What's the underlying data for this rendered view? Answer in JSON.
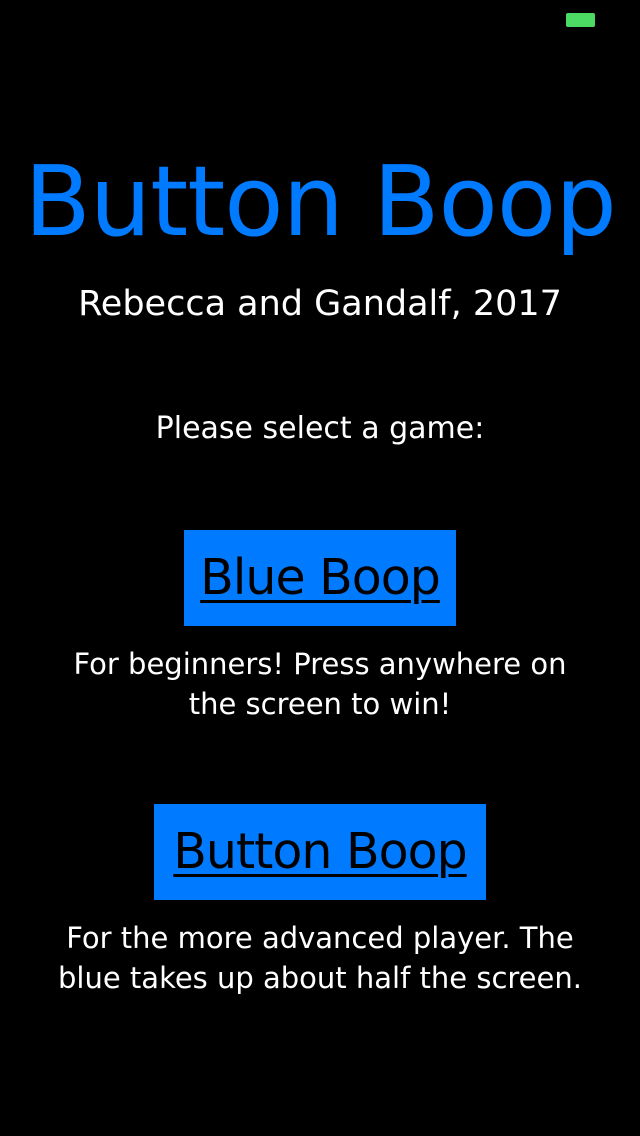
{
  "colors": {
    "background": "#000000",
    "accent": "#007AFF",
    "text": "#FFFFFF",
    "battery": "#4CD964"
  },
  "status_bar": {
    "battery_icon": "battery-icon"
  },
  "title": "Button Boop",
  "credits": "Rebecca and Gandalf, 2017",
  "prompt": "Please select a game:",
  "games": [
    {
      "label": "Blue Boop",
      "description_lines": [
        "For beginners! Press anywhere on",
        "the screen to win!"
      ]
    },
    {
      "label": "Button Boop",
      "description_lines": [
        "For the more advanced player. The",
        "blue takes up about half the screen."
      ]
    }
  ]
}
